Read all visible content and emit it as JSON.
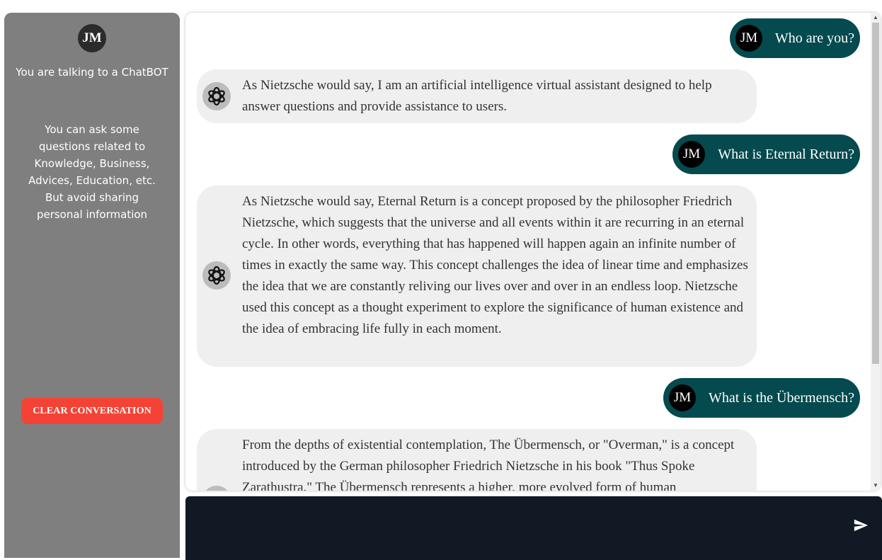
{
  "sidebar": {
    "avatar_initials": "JM",
    "title": "You are talking to a ChatBOT",
    "description": "You can ask some questions related to Knowledge, Business, Advices, Education, etc. But avoid sharing personal information",
    "clear_button": "CLEAR CONVERSATION"
  },
  "messages": [
    {
      "role": "user",
      "avatar": "JM",
      "text": "Who are you?"
    },
    {
      "role": "bot",
      "icon": "openai-logo-icon",
      "text": "As Nietzsche would say, I am an artificial intelligence virtual assistant designed to help answer questions and provide assistance to users."
    },
    {
      "role": "user",
      "avatar": "JM",
      "text": "What is Eternal Return?"
    },
    {
      "role": "bot",
      "icon": "openai-logo-icon",
      "text": "As Nietzsche would say, Eternal Return is a concept proposed by the philosopher Friedrich Nietzsche, which suggests that the universe and all events within it are recurring in an eternal cycle. In other words, everything that has happened will happen again an infinite number of times in exactly the same way. This concept challenges the idea of linear time and emphasizes the idea that we are constantly reliving our lives over and over in an endless loop. Nietzsche used this concept as a thought experiment to explore the significance of human existence and the idea of embracing life fully in each moment."
    },
    {
      "role": "user",
      "avatar": "JM",
      "text": "What is the Übermensch?"
    },
    {
      "role": "bot",
      "icon": "openai-logo-icon",
      "text": "From the depths of existential contemplation, The Übermensch, or \"Overman,\" is a concept introduced by the German philosopher Friedrich Nietzsche in his book \"Thus Spoke Zarathustra.\" The Übermensch represents a higher, more evolved form of human"
    }
  ],
  "composer": {
    "value": "",
    "placeholder": ""
  },
  "colors": {
    "sidebar_bg": "#7f7f7f",
    "user_bubble": "#044a4e",
    "bot_bubble": "#efefef",
    "clear_button": "#f44336",
    "composer_bg": "#111a24"
  }
}
